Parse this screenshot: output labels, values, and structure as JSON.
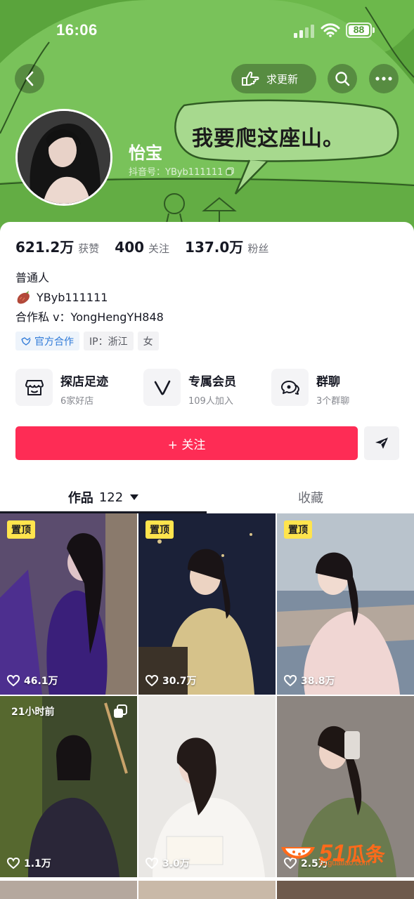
{
  "status_bar": {
    "time": "16:06",
    "battery": "88"
  },
  "header": {
    "update_label": "求更新",
    "nickname": "怡宝",
    "douyin_id": "抖音号：YByb111111",
    "banner_text": "我要爬这座山。"
  },
  "stats": [
    {
      "value": "621.2万",
      "label": "获赞"
    },
    {
      "value": "400",
      "label": "关注"
    },
    {
      "value": "137.0万",
      "label": "粉丝"
    }
  ],
  "bio": {
    "line1": "普通人",
    "line2": "YByb111111",
    "line3": "合作私 v：YongHengYH848"
  },
  "tags": {
    "official": "官方合作",
    "ip": "IP：浙江",
    "gender": "女"
  },
  "services": [
    {
      "title": "探店足迹",
      "sub": "6家好店",
      "icon": "store-icon"
    },
    {
      "title": "专属会员",
      "sub": "109人加入",
      "icon": "vip-v-icon"
    },
    {
      "title": "群聊",
      "sub": "3个群聊",
      "icon": "group-chat-icon"
    }
  ],
  "actions": {
    "follow": "+ 关注"
  },
  "tabs": {
    "works": "作品",
    "works_count": "122",
    "favorites": "收藏"
  },
  "posts": [
    {
      "badge": "置顶",
      "likes": "46.1万"
    },
    {
      "badge": "置顶",
      "likes": "30.7万"
    },
    {
      "badge": "置顶",
      "likes": "38.8万"
    },
    {
      "time": "21小时前",
      "likes": "1.1万"
    },
    {
      "likes": "3.0万"
    },
    {
      "likes": "2.5万"
    }
  ],
  "watermark": {
    "num": "51",
    "cn": "瓜条",
    "url": "51guatiao.com"
  },
  "colors": {
    "accent": "#fe2c55",
    "pin": "#ffe44d",
    "banner": "#66b046"
  }
}
